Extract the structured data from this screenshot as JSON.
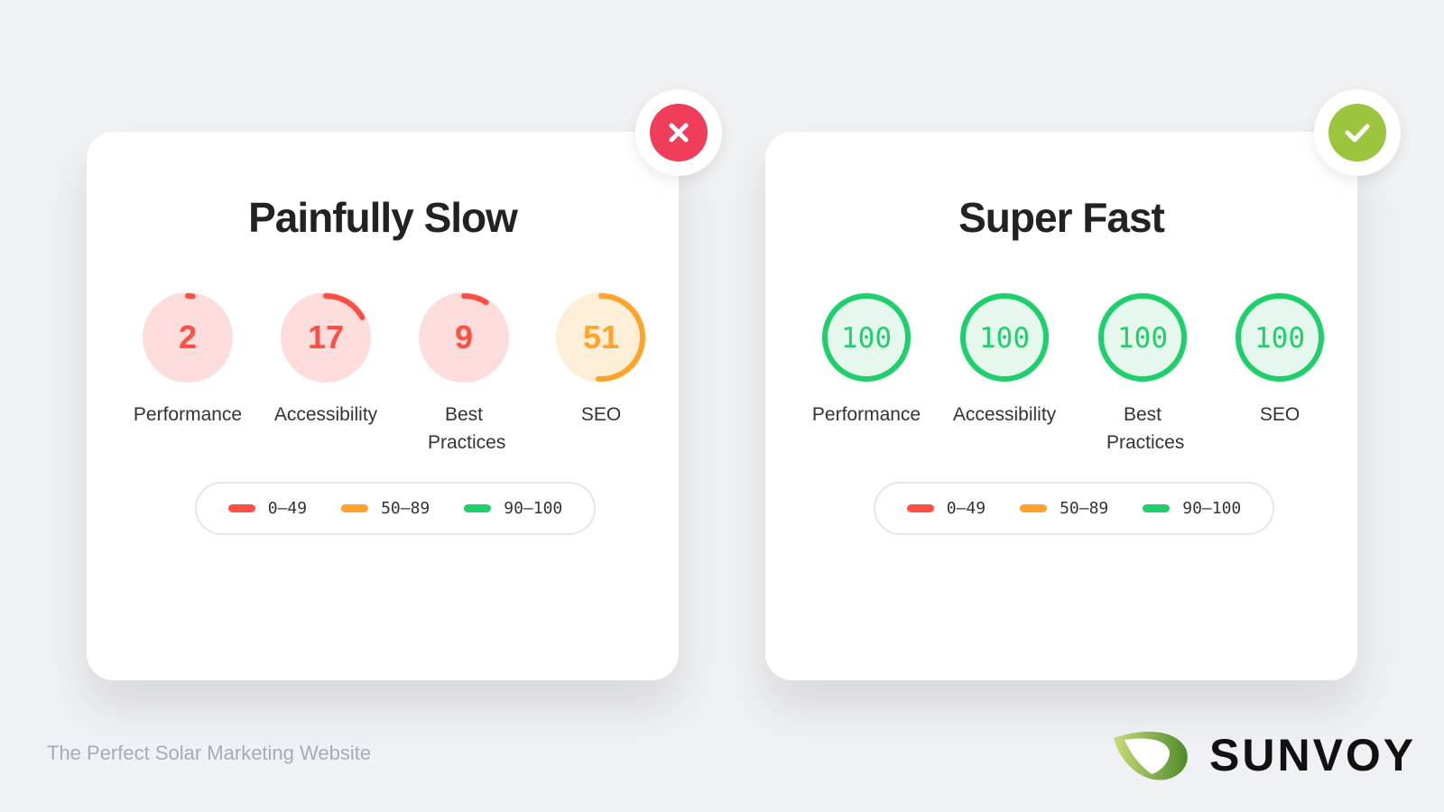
{
  "colors": {
    "red": "#ff4e42",
    "orange": "#ffa32b",
    "green": "#1fcf6c",
    "badge_bad": "#f03e5a",
    "badge_good": "#9bc53d"
  },
  "cards": [
    {
      "title": "Painfully Slow",
      "badge_icon": "x-icon",
      "gauges": [
        {
          "value": "2",
          "score": 2,
          "label": "Performance"
        },
        {
          "value": "17",
          "score": 17,
          "label": "Accessibility"
        },
        {
          "value": "9",
          "score": 9,
          "label": "Best Practices"
        },
        {
          "value": "51",
          "score": 51,
          "label": "SEO"
        }
      ]
    },
    {
      "title": "Super Fast",
      "badge_icon": "check-icon",
      "gauges": [
        {
          "value": "100",
          "score": 100,
          "label": "Performance"
        },
        {
          "value": "100",
          "score": 100,
          "label": "Accessibility"
        },
        {
          "value": "100",
          "score": 100,
          "label": "Best Practices"
        },
        {
          "value": "100",
          "score": 100,
          "label": "SEO"
        }
      ]
    }
  ],
  "legend": [
    "0–49",
    "50–89",
    "90–100"
  ],
  "footer": "The Perfect Solar Marketing Website",
  "brand": "SUNVOY"
}
